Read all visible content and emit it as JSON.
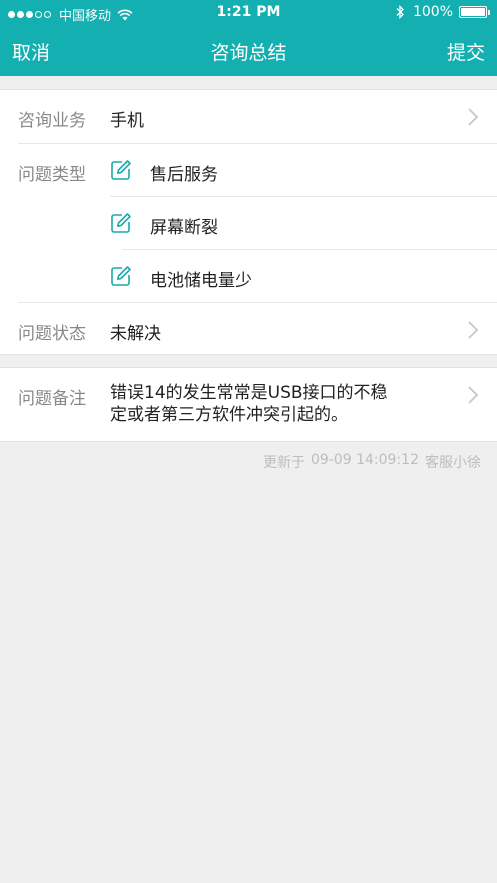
{
  "status_bar": {
    "carrier": "中国移动",
    "time": "1:21 PM",
    "battery": "100%",
    "battery_level": 1.0,
    "signal_bars": 3,
    "signal_total": 5
  },
  "nav": {
    "cancel": "取消",
    "title": "咨询总结",
    "submit": "提交"
  },
  "form": {
    "business": {
      "label": "咨询业务",
      "value": "手机"
    },
    "issue_type": {
      "label": "问题类型",
      "items": [
        "售后服务",
        "屏幕断裂",
        "电池储电量少"
      ]
    },
    "status": {
      "label": "问题状态",
      "value": "未解决"
    },
    "note": {
      "label": "问题备注",
      "line1": "错误14的发生常常是USB接口的不稳",
      "line2": "定或者第三方软件冲突引起的。"
    }
  },
  "footer": {
    "prefix": "更新于",
    "datetime": "09-09 14:09:12",
    "agent": "客服小徐"
  },
  "colors": {
    "accent": "#14b0b1",
    "icon": "#1aa9ab"
  }
}
